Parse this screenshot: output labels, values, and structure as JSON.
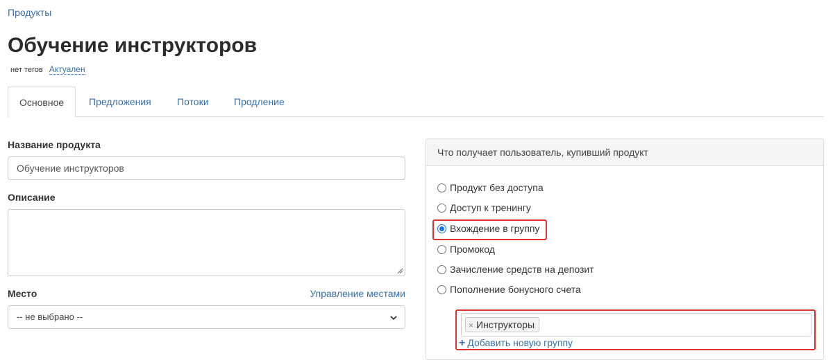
{
  "breadcrumb": {
    "label": "Продукты"
  },
  "page": {
    "title": "Обучение инструкторов",
    "tags_text": "нет тегов",
    "status": "Актуален"
  },
  "tabs": [
    {
      "label": "Основное",
      "active": true
    },
    {
      "label": "Предложения",
      "active": false
    },
    {
      "label": "Потоки",
      "active": false
    },
    {
      "label": "Продление",
      "active": false
    }
  ],
  "form": {
    "name_label": "Название продукта",
    "name_value": "Обучение инструкторов",
    "description_label": "Описание",
    "description_value": "",
    "place_label": "Место",
    "manage_places_link": "Управление местами",
    "place_selected": "-- не выбрано --"
  },
  "panel": {
    "heading": "Что получает пользователь, купивший продукт",
    "options": [
      {
        "label": "Продукт без доступа",
        "checked": false
      },
      {
        "label": "Доступ к тренингу",
        "checked": false
      },
      {
        "label": "Вхождение в группу",
        "checked": true
      },
      {
        "label": "Промокод",
        "checked": false
      },
      {
        "label": "Зачисление средств на депозит",
        "checked": false
      },
      {
        "label": "Пополнение бонусного счета",
        "checked": false
      }
    ],
    "group_tag": "Инструкторы",
    "group_tag_remove": "×",
    "add_group_icon": "+",
    "add_group_link": "Добавить новую группу"
  },
  "colors": {
    "link": "#3a70a8",
    "highlight": "#e03131",
    "radio_checked": "#1a73e8"
  }
}
